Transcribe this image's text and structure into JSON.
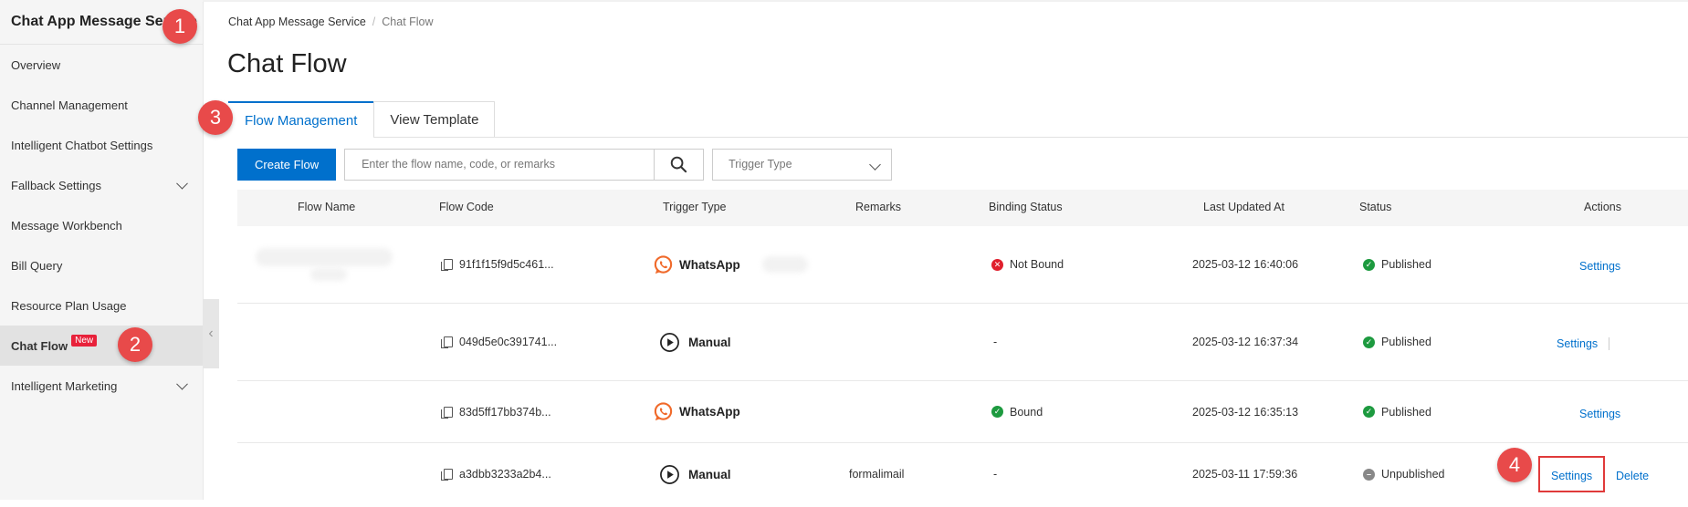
{
  "sidebar": {
    "title": "Chat App Message Service",
    "items": [
      {
        "label": "Overview"
      },
      {
        "label": "Channel Management"
      },
      {
        "label": "Intelligent Chatbot Settings"
      },
      {
        "label": "Fallback Settings"
      },
      {
        "label": "Message Workbench"
      },
      {
        "label": "Bill Query"
      },
      {
        "label": "Resource Plan Usage"
      },
      {
        "label": "Chat Flow",
        "badge": "New"
      },
      {
        "label": "Intelligent Marketing"
      }
    ]
  },
  "markers": [
    "1",
    "2",
    "3",
    "4"
  ],
  "breadcrumb": {
    "root": "Chat App Message Service",
    "separator": "/",
    "current": "Chat Flow"
  },
  "page_title": "Chat Flow",
  "tabs": [
    {
      "label": "Flow Management"
    },
    {
      "label": "View Template"
    }
  ],
  "toolbar": {
    "create_label": "Create Flow",
    "search_placeholder": "Enter the flow name, code, or remarks",
    "trigger_placeholder": "Trigger Type"
  },
  "table": {
    "columns": [
      "Flow Name",
      "Flow Code",
      "Trigger Type",
      "Remarks",
      "Binding Status",
      "Last Updated At",
      "Status",
      "Actions"
    ],
    "rows": [
      {
        "code": "91f1f15f9d5c461...",
        "trigger": "WhatsApp",
        "remarks": "",
        "binding": "Not Bound",
        "updated": "2025-03-12 16:40:06",
        "status": "Published",
        "action1": "Settings"
      },
      {
        "code": "049d5e0c391741...",
        "trigger": "Manual",
        "remarks": "",
        "binding": "-",
        "updated": "2025-03-12 16:37:34",
        "status": "Published",
        "action1": "Settings"
      },
      {
        "code": "83d5ff17bb374b...",
        "trigger": "WhatsApp",
        "remarks": "",
        "binding": "Bound",
        "updated": "2025-03-12 16:35:13",
        "status": "Published",
        "action1": "Settings"
      },
      {
        "code": "a3dbb3233a2b4...",
        "trigger": "Manual",
        "remarks": "formalimail",
        "binding": "-",
        "updated": "2025-03-11 17:59:36",
        "status": "Unpublished",
        "action1": "Settings",
        "action2": "Delete"
      }
    ]
  },
  "colors": {
    "primary": "#0070cc",
    "marker": "#e84a4a",
    "success": "#1d9a3f",
    "error": "#e0202d",
    "whatsapp": "#f06a2b"
  }
}
